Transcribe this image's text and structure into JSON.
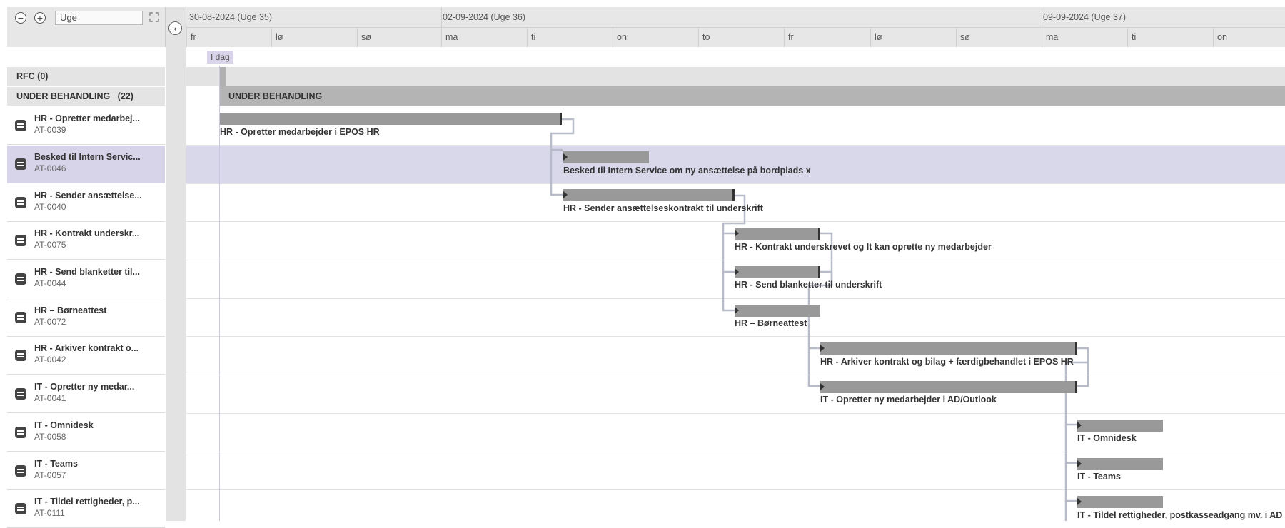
{
  "toolbar": {
    "zoom_out_symbol": "−",
    "zoom_in_symbol": "+",
    "view_value": "Uge",
    "fit_symbol": "⤢",
    "collapse_symbol": "‹"
  },
  "timeline": {
    "weeks": [
      "30-08-2024 (Uge 35)",
      "02-09-2024 (Uge 36)",
      "09-09-2024 (Uge 37)"
    ],
    "days": [
      "fr",
      "lø",
      "sø",
      "ma",
      "ti",
      "on",
      "to",
      "fr",
      "lø",
      "sø",
      "ma",
      "ti",
      "on"
    ],
    "today_label": "I dag"
  },
  "groups": {
    "rfc": "RFC (0)",
    "under_behandling": "UNDER BEHANDLING   (22)",
    "under_behandling_bar": "UNDER BEHANDLING"
  },
  "tasks": [
    {
      "title": "HR - Opretter medarbej...",
      "id": "AT-0039",
      "bar_label": "HR - Opretter medarbejder i EPOS HR"
    },
    {
      "title": "Besked til Intern Servic...",
      "id": "AT-0046",
      "bar_label": "Besked til Intern Service om ny ansættelse på bordplads x"
    },
    {
      "title": "HR - Sender ansættelse...",
      "id": "AT-0040",
      "bar_label": "HR - Sender ansættelseskontrakt til underskrift"
    },
    {
      "title": "HR - Kontrakt underskr...",
      "id": "AT-0075",
      "bar_label": "HR - Kontrakt underskrevet og It kan oprette ny medarbejder"
    },
    {
      "title": "HR - Send blanketter til...",
      "id": "AT-0044",
      "bar_label": "HR - Send blanketter til underskrift"
    },
    {
      "title": "HR – Børneattest",
      "id": "AT-0072",
      "bar_label": "HR – Børneattest"
    },
    {
      "title": "HR - Arkiver kontrakt o...",
      "id": "AT-0042",
      "bar_label": "HR - Arkiver kontrakt og bilag + færdigbehandlet i EPOS HR"
    },
    {
      "title": "IT - Opretter ny medar...",
      "id": "AT-0041",
      "bar_label": "IT - Opretter ny medarbejder i AD/Outlook"
    },
    {
      "title": "IT - Omnidesk",
      "id": "AT-0058",
      "bar_label": "IT - Omnidesk"
    },
    {
      "title": "IT - Teams",
      "id": "AT-0057",
      "bar_label": "IT - Teams"
    },
    {
      "title": "IT - Tildel rettigheder, p...",
      "id": "AT-0111",
      "bar_label": "IT - Tildel rettigheder, postkasseadgang mv. i AD"
    }
  ],
  "colors": {
    "bar": "#999999",
    "selected_row": "#d7d4ea",
    "header_bg": "#e7e7e7",
    "dependency_line": "#b8bcc8"
  },
  "icons": [
    "zoom-out-icon",
    "zoom-in-icon",
    "fit-screen-icon",
    "collapse-icon",
    "task-icon"
  ]
}
